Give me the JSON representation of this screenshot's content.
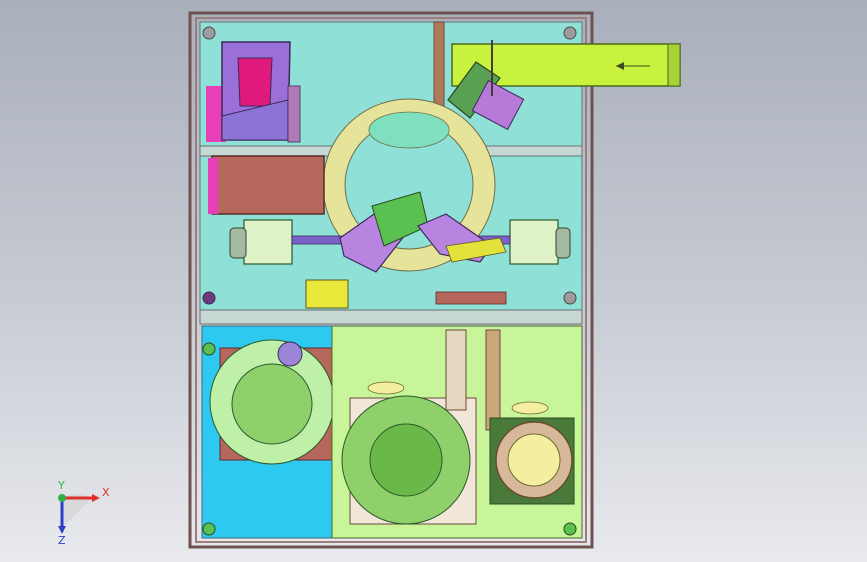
{
  "viewport": {
    "background_top": "#a9afbb",
    "background_bottom": "#e9eaee"
  },
  "triad": {
    "x_label": "X",
    "y_label": "Y",
    "z_label": "Z",
    "colors": {
      "x": "#e0302a",
      "y": "#2fb04a",
      "z": "#2b3fc8"
    }
  },
  "model": {
    "frame_color": "#7a5a58",
    "upper_panel_color": "#8fe0d6",
    "lower_left_panel_color": "#2ec9f0",
    "lower_right_panel_color": "#c9f59a",
    "turntable_color": "#e6e49a",
    "feed_rail_color": "#c8f23e",
    "hopper_color": "#9b6fd8",
    "hopper_frame_color": "#e63fb8",
    "bowl_feeder_color": "#8fd06a",
    "plate_color": "#b8675c"
  }
}
